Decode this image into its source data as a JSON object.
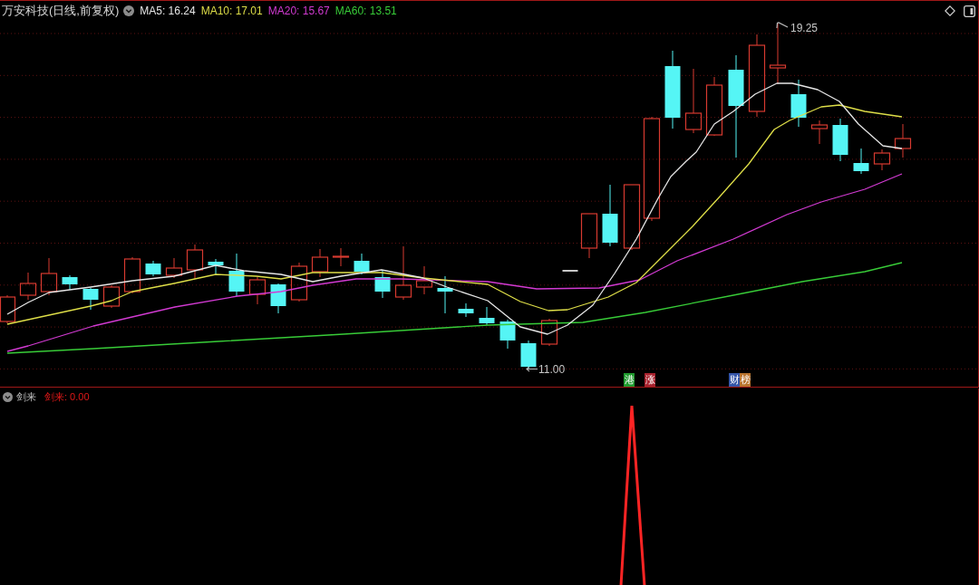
{
  "chart_header": {
    "title": "万安科技(日线,前复权)",
    "ma_legend": [
      {
        "label": "MA5: 16.24",
        "color": "#e6e6e6"
      },
      {
        "label": "MA10: 17.01",
        "color": "#dede48"
      },
      {
        "label": "MA20: 15.67",
        "color": "#d23ad2"
      },
      {
        "label": "MA60: 13.51",
        "color": "#38cc38"
      }
    ]
  },
  "price_chart": {
    "high_label": "19.25",
    "low_label": "11.00",
    "event_markers": [
      {
        "label": "港",
        "color": "#1f9a2e"
      },
      {
        "label": "涨",
        "color": "#a8222e"
      },
      {
        "label": "财",
        "color": "#3556a8"
      },
      {
        "label": "榜",
        "color": "#b8742e"
      }
    ]
  },
  "indicator_panel": {
    "name": "剑来",
    "reading": "剑来: 0.00"
  }
}
